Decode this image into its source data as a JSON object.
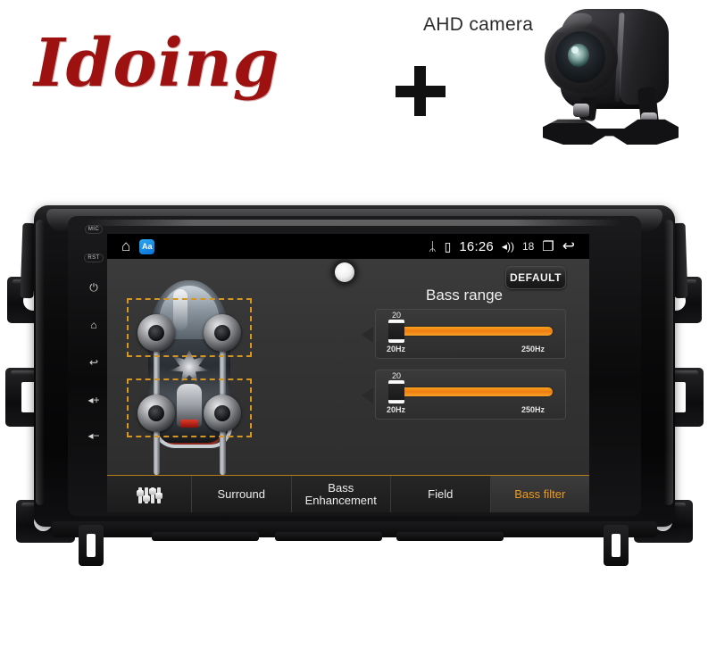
{
  "promo": {
    "brand": "Idoing",
    "accessory_label": "AHD camera",
    "plus_symbol": "+",
    "camera_icon_name": "ahd-camera-product-image"
  },
  "head_unit": {
    "side_keys": [
      {
        "type": "label",
        "text": "MIC"
      },
      {
        "type": "label",
        "text": "RST"
      },
      {
        "type": "icon",
        "text": "⏻",
        "name": "power"
      },
      {
        "type": "icon",
        "text": "⌂",
        "name": "home"
      },
      {
        "type": "icon",
        "text": "↩",
        "name": "back"
      },
      {
        "type": "icon",
        "text": "◂+",
        "name": "volume-up"
      },
      {
        "type": "icon",
        "text": "◂−",
        "name": "volume-down"
      }
    ]
  },
  "status_bar": {
    "home_icon": "⌂",
    "app_badge_text": "Aa",
    "bluetooth_icon": "ᛦ",
    "storage_icon": "▯",
    "time": "16:26",
    "volume_icon": "◂))",
    "volume_level": "18",
    "recents_icon": "❐",
    "back_icon": "↩"
  },
  "screen": {
    "default_button": "DEFAULT",
    "panel_title": "Bass range",
    "car_diagram": {
      "name": "car-speaker-layout",
      "speakers": [
        "front-left",
        "front-right",
        "rear-left",
        "rear-right"
      ],
      "selections": [
        "front-pair",
        "rear-pair"
      ]
    },
    "sliders": [
      {
        "name": "bass-range-front",
        "value": "20",
        "min_label": "20Hz",
        "max_label": "250Hz",
        "fill_percent": 100
      },
      {
        "name": "bass-range-rear",
        "value": "20",
        "min_label": "20Hz",
        "max_label": "250Hz",
        "fill_percent": 100
      }
    ],
    "tabs": [
      {
        "label": "",
        "icon": "equalizer-icon",
        "active": false
      },
      {
        "label": "Surround",
        "active": false
      },
      {
        "label": "Bass Enhancement",
        "active": false
      },
      {
        "label": "Field",
        "active": false
      },
      {
        "label": "Bass filter",
        "active": true
      }
    ]
  },
  "colors": {
    "brand_red": "#9e1111",
    "accent_orange": "#f09a20",
    "slider_orange": "#ef7d12",
    "selection_dashed": "#d79521",
    "screen_bg": "#343434",
    "status_bar_bg": "#000000"
  }
}
